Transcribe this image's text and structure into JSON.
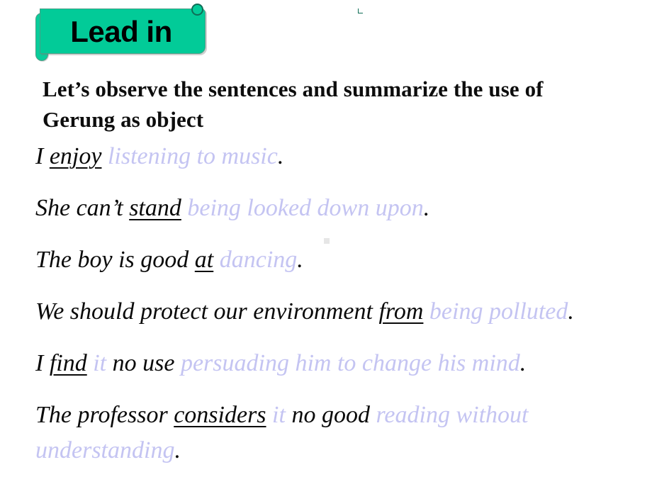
{
  "slide": {
    "background_color": "#ffffff"
  },
  "banner": {
    "label": "Lead in",
    "fill_color": "#02cb98",
    "border_color": "#4a9e86",
    "text_color": "#000000",
    "shape": "scroll-banner"
  },
  "intro": {
    "text": "Let’s observe the sentences and summarize the use of Gerung as object"
  },
  "colors": {
    "gerund_text": "#c4c4f2",
    "normal_text": "#0a0a0a",
    "banner_green": "#02cb98"
  },
  "sentences": [
    {
      "id": "sentence-1",
      "segments": [
        {
          "kind": "plain",
          "text": "I "
        },
        {
          "kind": "key",
          "text": "enjoy"
        },
        {
          "kind": "plain",
          "text": " "
        },
        {
          "kind": "gerund",
          "text": "listening to music"
        },
        {
          "kind": "period",
          "text": "."
        }
      ]
    },
    {
      "id": "sentence-2",
      "segments": [
        {
          "kind": "plain",
          "text": "She can’t "
        },
        {
          "kind": "key",
          "text": "stand"
        },
        {
          "kind": "plain",
          "text": " "
        },
        {
          "kind": "gerund",
          "text": "being looked down upon"
        },
        {
          "kind": "period",
          "text": "."
        }
      ]
    },
    {
      "id": "sentence-3",
      "segments": [
        {
          "kind": "plain",
          "text": "The boy is good "
        },
        {
          "kind": "key",
          "text": "at"
        },
        {
          "kind": "plain",
          "text": " "
        },
        {
          "kind": "gerund",
          "text": "dancing"
        },
        {
          "kind": "period",
          "text": "."
        }
      ]
    },
    {
      "id": "sentence-4",
      "segments": [
        {
          "kind": "plain",
          "text": "We should protect our environment "
        },
        {
          "kind": "key",
          "text": "from"
        },
        {
          "kind": "plain",
          "text": " "
        },
        {
          "kind": "gerund",
          "text": "being polluted"
        },
        {
          "kind": "period",
          "text": "."
        }
      ]
    },
    {
      "id": "sentence-5",
      "segments": [
        {
          "kind": "plain",
          "text": "I "
        },
        {
          "kind": "key",
          "text": "find"
        },
        {
          "kind": "plain",
          "text": " "
        },
        {
          "kind": "gerund",
          "text": "it"
        },
        {
          "kind": "plain",
          "text": " no use "
        },
        {
          "kind": "gerund",
          "text": "persuading him to change his mind"
        },
        {
          "kind": "period",
          "text": "."
        }
      ]
    },
    {
      "id": "sentence-6",
      "segments": [
        {
          "kind": "plain",
          "text": "The professor "
        },
        {
          "kind": "key",
          "text": "considers"
        },
        {
          "kind": "plain",
          "text": " "
        },
        {
          "kind": "gerund",
          "text": "it"
        },
        {
          "kind": "plain",
          "text": " no good "
        },
        {
          "kind": "gerund",
          "text": "reading without understanding"
        },
        {
          "kind": "period",
          "text": "."
        }
      ]
    }
  ]
}
